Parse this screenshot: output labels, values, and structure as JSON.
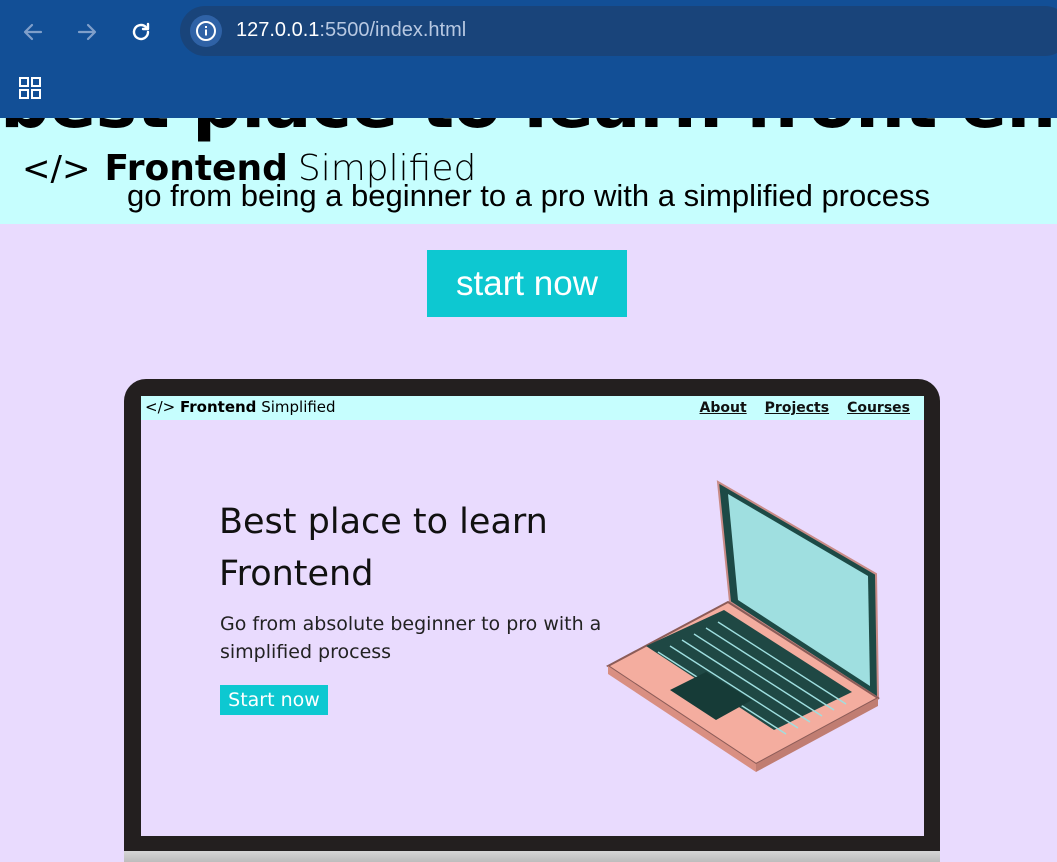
{
  "browser": {
    "url_host": "127.0.0.1",
    "url_rest": ":5500/index.html"
  },
  "page": {
    "hero_title": "best place to learn front end",
    "logo_mark": "</>",
    "logo_bold": "Frontend",
    "logo_regular": "Simplified",
    "subtitle": "go from being a beginner to a pro with a simplified process",
    "start_button": "start now"
  },
  "mockup": {
    "logo_mark": "</>",
    "logo_bold": "Frontend",
    "logo_regular": "Simplified",
    "links": [
      "About",
      "Projects",
      "Courses"
    ],
    "heading": "Best place to learn Frontend",
    "paragraph": "Go from absolute beginner to pro with a simplified process",
    "button": "Start now"
  },
  "colors": {
    "chrome": "#124f96",
    "header_band": "#c6fefe",
    "page_bg": "#e9dbfe",
    "accent": "#0dc8d1"
  }
}
